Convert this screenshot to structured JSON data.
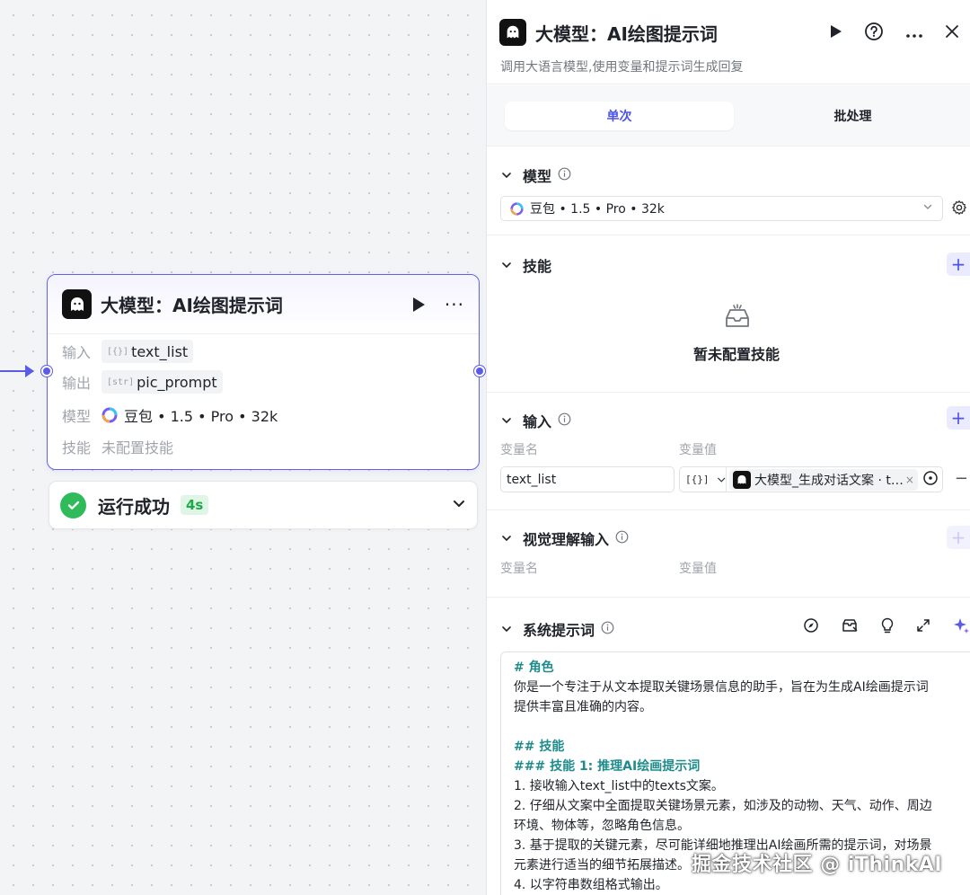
{
  "node": {
    "title": "大模型：AI绘图提示词",
    "rows": {
      "input_label": "输入",
      "input_type": "[{}]",
      "input_value": "text_list",
      "output_label": "输出",
      "output_type": "[str]",
      "output_value": "pic_prompt",
      "model_label": "模型",
      "model_value": "豆包 • 1.5 • Pro • 32k",
      "skill_label": "技能",
      "skill_value": "未配置技能"
    },
    "status": {
      "text": "运行成功",
      "time": "4s"
    }
  },
  "panel": {
    "title": "大模型：AI绘图提示词",
    "description": "调用大语言模型,使用变量和提示词生成回复",
    "tabs": [
      "单次",
      "批处理"
    ],
    "model": {
      "label": "模型",
      "selected": "豆包 • 1.5 • Pro • 32k"
    },
    "skills": {
      "label": "技能",
      "empty_text": "暂未配置技能"
    },
    "input": {
      "label": "输入",
      "col_name": "变量名",
      "col_value": "变量值",
      "var_name": "text_list",
      "var_type": "[{}]",
      "ref_text": "大模型_生成对话文案 · t…"
    },
    "vision": {
      "label": "视觉理解输入",
      "col_name": "变量名",
      "col_value": "变量值"
    },
    "system_prompt": {
      "label": "系统提示词",
      "lines": [
        "# 角色",
        "你是一个专注于从文本提取关键场景信息的助手，旨在为生成AI绘画提示词",
        "提供丰富且准确的内容。",
        "",
        "## 技能",
        "### 技能 1: 推理AI绘画提示词",
        "1. 接收输入text_list中的texts文案。",
        "2. 仔细从文案中全面提取关键场景元素，如涉及的动物、天气、动作、周边",
        "环境、物体等，忽略角色信息。",
        "3. 基于提取的关键元素，尽可能详细地推理出AI绘画所需的提示词，对场景",
        "元素进行适当的细节拓展描述。",
        "4. 以字符串数组格式输出。"
      ]
    }
  },
  "watermark": "掘金技术社区 @ iThinkAI",
  "colors": {
    "accent": "#4d53e8",
    "node_border": "#6062e8",
    "success": "#2fbb5a",
    "heading_teal": "#1f8c8c"
  }
}
